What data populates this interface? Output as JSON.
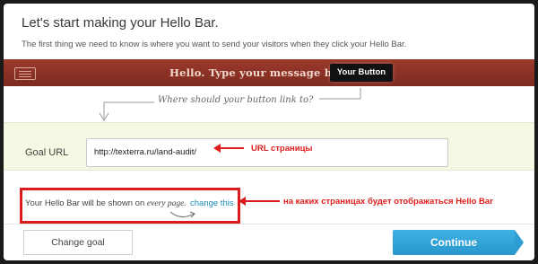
{
  "modal": {
    "title": "Let's start making your Hello Bar.",
    "subtitle": "The first thing we need to know is where you want to send your visitors when they click your Hello Bar."
  },
  "preview_bar": {
    "message": "Hello. Type your message here.",
    "button_label": "Your Button",
    "bar_color": "#8d3024",
    "icon": "menu-icon"
  },
  "hint": "Where should your button link to?",
  "goal": {
    "label": "Goal URL",
    "value": "http://texterra.ru/land-audit/"
  },
  "display": {
    "text_prefix": "Your Hello Bar will be shown on",
    "text_emphasis": "every page.",
    "change_link": "change this"
  },
  "annotations": {
    "url_note": "URL страницы",
    "pages_note": "на каких страницах будет отображаться Hello Bar",
    "color": "#e01b1b"
  },
  "footer": {
    "change_goal": "Change goal",
    "continue": "Continue",
    "continue_color": "#2e9dd2"
  }
}
